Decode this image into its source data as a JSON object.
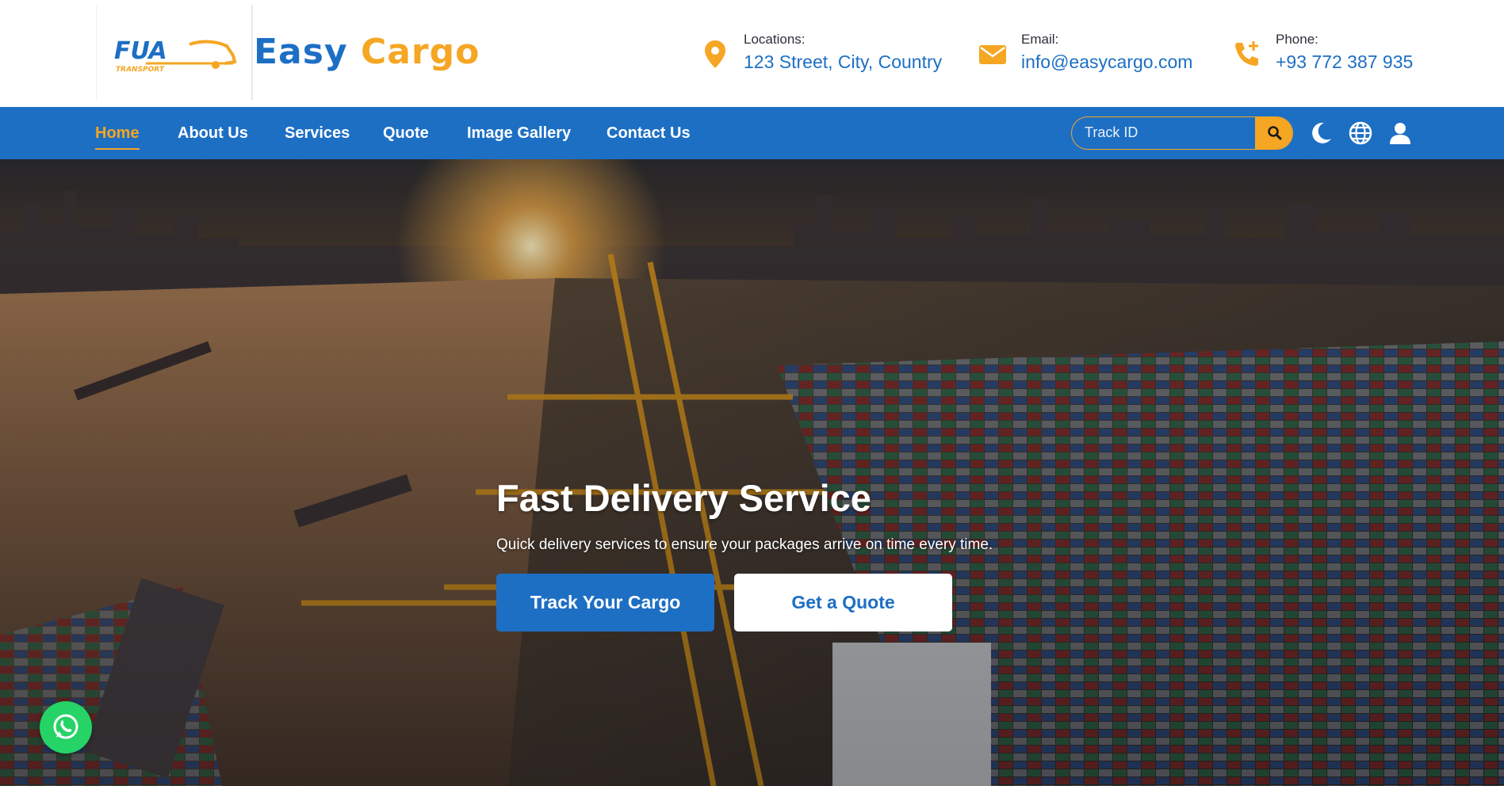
{
  "brand": {
    "name_part1": "Easy",
    "name_part2": "Cargo",
    "logo_text": "FUA",
    "logo_subtext": "TRANSPORT"
  },
  "contact": {
    "location": {
      "label": "Locations:",
      "value": "123 Street, City, Country",
      "icon": "location-pin-icon"
    },
    "email": {
      "label": "Email:",
      "value": "info@easycargo.com",
      "icon": "envelope-icon"
    },
    "phone": {
      "label": "Phone:",
      "value": "+93 772 387 935",
      "icon": "phone-add-icon"
    }
  },
  "nav": {
    "items": [
      {
        "label": "Home",
        "active": true
      },
      {
        "label": "About Us",
        "active": false
      },
      {
        "label": "Services",
        "active": false
      },
      {
        "label": "Quote",
        "active": false
      },
      {
        "label": "Image Gallery",
        "active": false
      },
      {
        "label": "Contact Us",
        "active": false
      }
    ],
    "track": {
      "placeholder": "Track ID",
      "button_icon": "search-icon"
    },
    "icons": [
      "moon-icon",
      "globe-icon",
      "user-icon"
    ]
  },
  "hero": {
    "title": "Fast Delivery Service",
    "subtitle": "Quick delivery services to ensure your packages arrive on time every time.",
    "primary_button": "Track Your Cargo",
    "secondary_button": "Get a Quote"
  },
  "floating": {
    "whatsapp_icon": "whatsapp-icon"
  },
  "colors": {
    "primary": "#1d6fc4",
    "accent": "#f5a623",
    "whatsapp": "#25d366",
    "text_dark": "#2b2f38"
  }
}
